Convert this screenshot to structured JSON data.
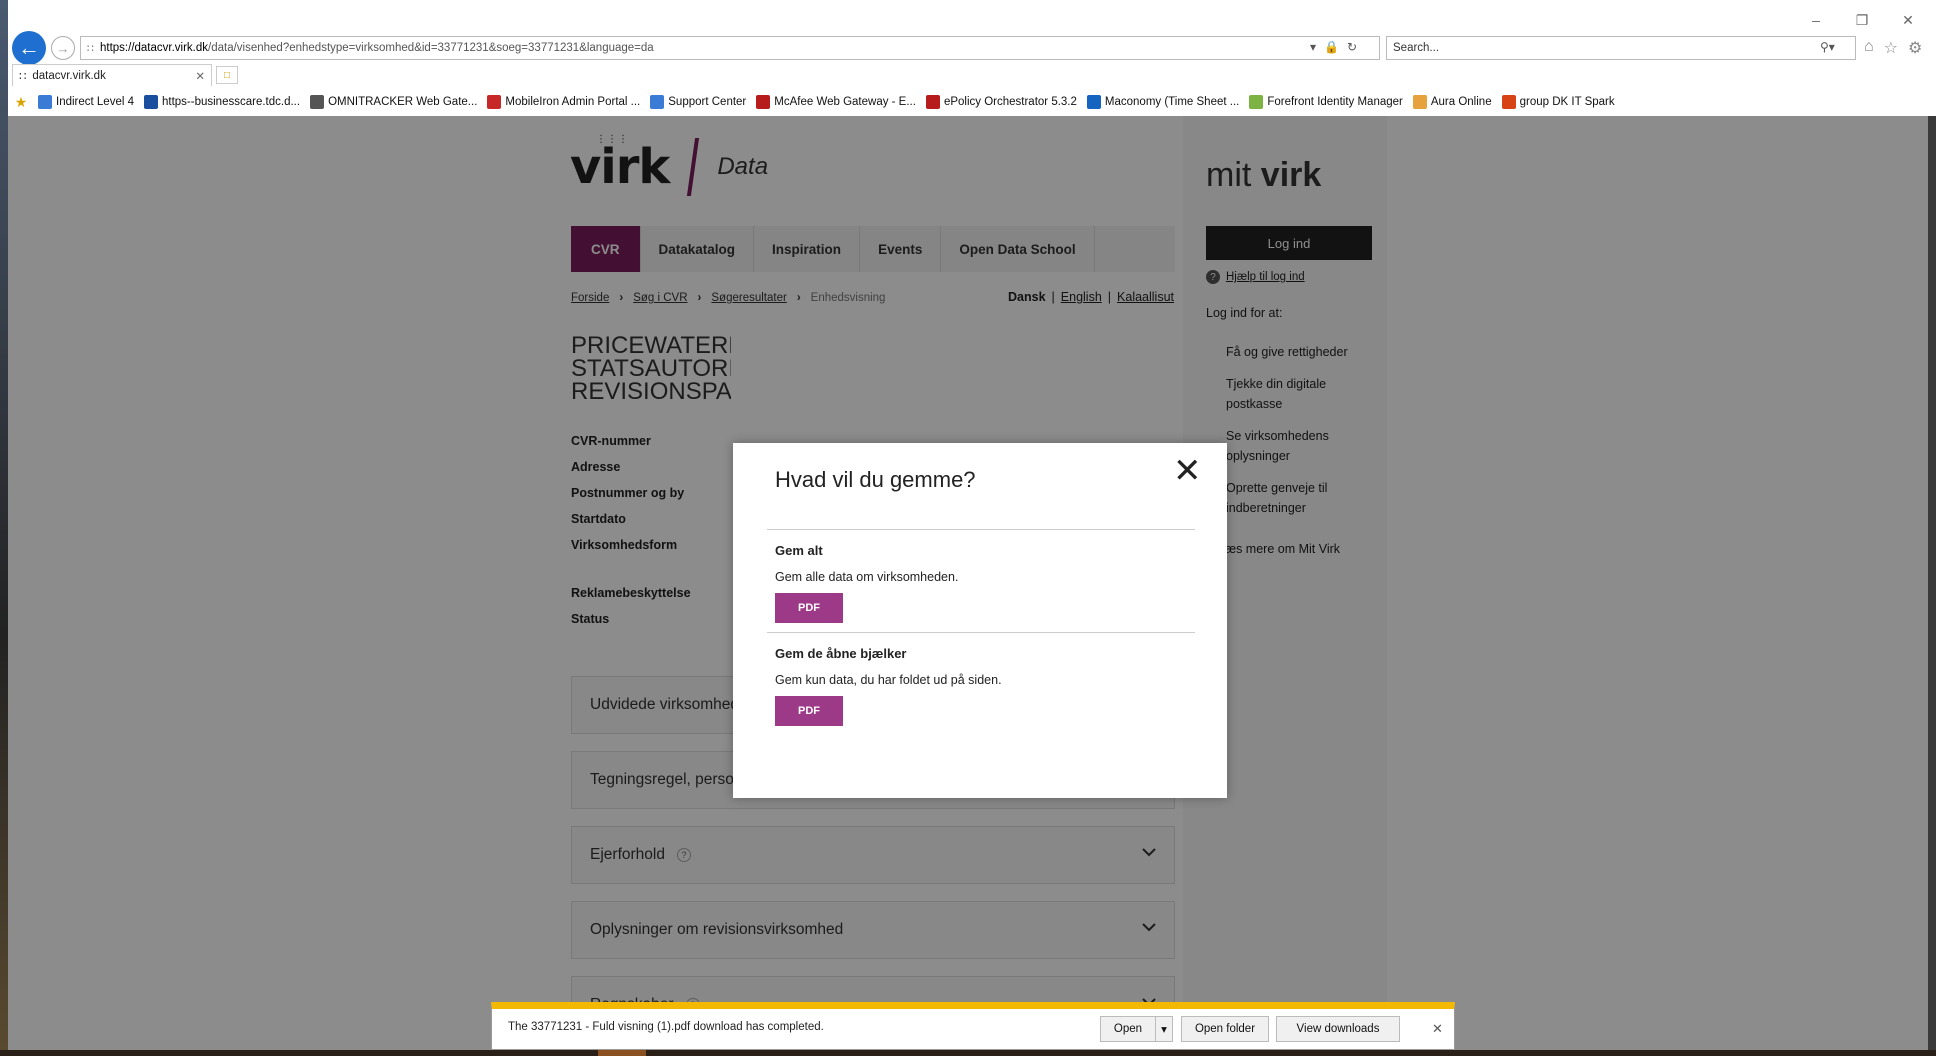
{
  "browser": {
    "url_host": "https://datacvr.virk.dk",
    "url_rest": "/data/visenhed?enhedstype=virksomhed&id=33771231&soeg=33771231&language=da",
    "search_placeholder": "Search...",
    "tab_title": "datacvr.virk.dk",
    "favorites": [
      {
        "label": "Indirect Level 4",
        "icon": "ie-page-icon",
        "color": "#3a7bd5"
      },
      {
        "label": "https--businesscare.tdc.d...",
        "icon": "tdc-icon",
        "color": "#1a4fa0"
      },
      {
        "label": "OMNITRACKER Web Gate...",
        "icon": "omnitracker-icon",
        "color": "#555555"
      },
      {
        "label": "MobileIron Admin Portal ...",
        "icon": "mobileiron-icon",
        "color": "#c62828"
      },
      {
        "label": "Support Center",
        "icon": "ie-page-icon",
        "color": "#3a7bd5"
      },
      {
        "label": "McAfee  Web Gateway - E...",
        "icon": "mcafee-icon",
        "color": "#b71c1c"
      },
      {
        "label": "ePolicy Orchestrator 5.3.2",
        "icon": "mcafee-icon",
        "color": "#b71c1c"
      },
      {
        "label": "Maconomy (Time Sheet ...",
        "icon": "maconomy-icon",
        "color": "#1565c0"
      },
      {
        "label": "Forefront Identity Manager",
        "icon": "forefront-icon",
        "color": "#7cb342"
      },
      {
        "label": "Aura Online",
        "icon": "aura-icon",
        "color": "#e6a23c"
      },
      {
        "label": "group DK IT Spark",
        "icon": "spark-icon",
        "color": "#d84315"
      }
    ]
  },
  "site": {
    "logo_text": "virk",
    "logo_sub": "Data",
    "mit_virk_a": "mit",
    "mit_virk_b": "virk",
    "nav": [
      "CVR",
      "Datakatalog",
      "Inspiration",
      "Events",
      "Open Data School"
    ],
    "breadcrumb": [
      "Forside",
      "Søg i CVR",
      "Søgeresultater",
      "Enhedsvisning"
    ],
    "lang_selected": "Dansk",
    "lang_others": [
      "English",
      "Kalaallisut"
    ],
    "company_lines": [
      "PRICEWATERHOUSECOOPERS",
      "STATSAUTORISERET",
      "REVISIONSPARTNERSELSKAB"
    ],
    "fields": [
      "CVR-nummer",
      "Adresse",
      "Postnummer og by",
      "Startdato",
      "Virksomhedsform"
    ],
    "fields2": [
      "Reklamebeskyttelse",
      "Status"
    ],
    "accordions": [
      "Udvidede virksomhedsoplysninger",
      "Tegningsregel, personkreds og revisor",
      "Ejerforhold",
      "Oplysninger om revisionsvirksomhed",
      "Regnskaber"
    ],
    "login_button": "Log ind",
    "help_login": "Hjælp til log ind",
    "login_for": "Log ind for at:",
    "benefits": [
      "Få og give rettigheder",
      "Tjekke din digitale postkasse",
      "Se virksomhedens oplysninger",
      "Oprette genveje til indberetninger"
    ],
    "read_more": "Læs mere om Mit Virk"
  },
  "modal": {
    "title": "Hvad vil du gemme?",
    "section1_title": "Gem alt",
    "section1_desc": "Gem alle data om virksomheden.",
    "section2_title": "Gem de åbne bjælker",
    "section2_desc": "Gem kun data, du har foldet ud på siden.",
    "pdf_label": "PDF"
  },
  "download": {
    "message": "The 33771231 - Fuld visning (1).pdf download has completed.",
    "open": "Open",
    "open_folder": "Open folder",
    "view_downloads": "View downloads"
  }
}
